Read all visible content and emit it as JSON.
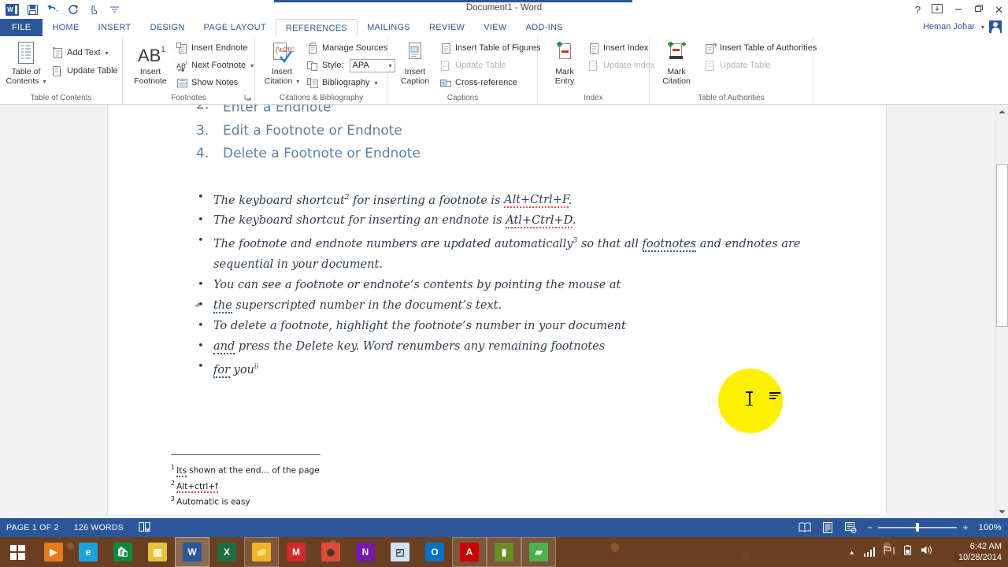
{
  "titlebar": {
    "document_title": "Document1 - Word",
    "quick_access": [
      {
        "name": "word-logo-icon",
        "label": "W"
      },
      {
        "name": "save-icon",
        "label": "💾"
      },
      {
        "name": "undo-icon",
        "label": "↶"
      },
      {
        "name": "redo-icon",
        "label": "↻"
      },
      {
        "name": "touch-mode-icon",
        "label": "☝"
      },
      {
        "name": "customize-qat-icon",
        "label": "≡"
      }
    ],
    "window_controls": [
      {
        "name": "help-button",
        "label": "?"
      },
      {
        "name": "ribbon-display-options-button",
        "label": "⬜"
      },
      {
        "name": "minimize-button",
        "label": "—"
      },
      {
        "name": "restore-button",
        "label": "❐"
      },
      {
        "name": "close-button",
        "label": "✕"
      }
    ]
  },
  "tabs": [
    {
      "label": "FILE",
      "active": false
    },
    {
      "label": "HOME",
      "active": false
    },
    {
      "label": "INSERT",
      "active": false
    },
    {
      "label": "DESIGN",
      "active": false
    },
    {
      "label": "PAGE LAYOUT",
      "active": false
    },
    {
      "label": "REFERENCES",
      "active": true
    },
    {
      "label": "MAILINGS",
      "active": false
    },
    {
      "label": "REVIEW",
      "active": false
    },
    {
      "label": "VIEW",
      "active": false
    },
    {
      "label": "ADD-INS",
      "active": false
    }
  ],
  "account": {
    "name": "Heman Johar",
    "caret": "▾"
  },
  "ribbon": {
    "groups": [
      {
        "name": "table-of-contents",
        "label": "Table of Contents",
        "big_button": {
          "label_line1": "Table of",
          "label_line2": "Contents",
          "caret": "▾"
        },
        "buttons": [
          {
            "label": "Add Text",
            "caret": "▾",
            "disabled": false
          },
          {
            "label": "Update Table",
            "caret": "",
            "disabled": false
          }
        ]
      },
      {
        "name": "footnotes",
        "label": "Footnotes",
        "big_button": {
          "glyph": "AB",
          "sup": "1",
          "label_line1": "Insert",
          "label_line2": "Footnote"
        },
        "buttons": [
          {
            "label": "Insert Endnote",
            "caret": "",
            "disabled": false
          },
          {
            "label": "Next Footnote",
            "caret": "▾",
            "disabled": false
          },
          {
            "label": "Show Notes",
            "caret": "",
            "disabled": false
          }
        ],
        "dialog_launcher": "⤵"
      },
      {
        "name": "citations-bibliography",
        "label": "Citations & Bibliography",
        "big_button": {
          "label_line1": "Insert",
          "label_line2": "Citation",
          "caret": "▾"
        },
        "buttons": [
          {
            "label": "Manage Sources",
            "caret": "",
            "disabled": false
          },
          {
            "label": "Style:",
            "caret": "",
            "disabled": false
          },
          {
            "label": "Bibliography",
            "caret": "▾",
            "disabled": false
          }
        ],
        "style_value": "APA",
        "style_caret": "▾"
      },
      {
        "name": "captions",
        "label": "Captions",
        "big_button": {
          "label_line1": "Insert",
          "label_line2": "Caption"
        },
        "buttons": [
          {
            "label": "Insert Table of Figures",
            "caret": "",
            "disabled": false
          },
          {
            "label": "Update Table",
            "caret": "",
            "disabled": true
          },
          {
            "label": "Cross-reference",
            "caret": "",
            "disabled": false
          }
        ]
      },
      {
        "name": "index",
        "label": "Index",
        "big_button": {
          "label_line1": "Mark",
          "label_line2": "Entry"
        },
        "buttons": [
          {
            "label": "Insert Index",
            "caret": "",
            "disabled": false
          },
          {
            "label": "Update Index",
            "caret": "",
            "disabled": true
          }
        ]
      },
      {
        "name": "table-of-authorities",
        "label": "Table of Authorities",
        "big_button": {
          "label_line1": "Mark",
          "label_line2": "Citation"
        },
        "buttons": [
          {
            "label": "Insert Table of Authorities",
            "caret": "",
            "disabled": false
          },
          {
            "label": "Update Table",
            "caret": "",
            "disabled": true
          }
        ]
      }
    ]
  },
  "document": {
    "numbered_list": [
      {
        "num": "2.",
        "text": "Enter a Endnote",
        "sup": "i"
      },
      {
        "num": "3.",
        "text": "Edit a Footnote or Endnote",
        "sup": ""
      },
      {
        "num": "4.",
        "text": "Delete a Footnote or Endnote",
        "sup": ""
      }
    ],
    "bullets": [
      {
        "parts": [
          {
            "t": "The keyboard shortcut",
            "style": ""
          },
          {
            "t": "2",
            "style": "sup"
          },
          {
            "t": " for inserting a footnote is ",
            "style": ""
          },
          {
            "t": "Alt+Ctrl+F",
            "style": "sp-err"
          },
          {
            "t": ".",
            "style": ""
          }
        ]
      },
      {
        "parts": [
          {
            "t": "The keyboard shortcut for inserting an endnote is ",
            "style": ""
          },
          {
            "t": "Atl+Ctrl+D",
            "style": "sp-err"
          },
          {
            "t": ".",
            "style": ""
          }
        ]
      },
      {
        "parts": [
          {
            "t": "The footnote and endnote numbers are updated automatically",
            "style": ""
          },
          {
            "t": "3",
            "style": "sup"
          },
          {
            "t": " so that all ",
            "style": ""
          },
          {
            "t": "footnotes",
            "style": "gr-err"
          },
          {
            "t": " and endnotes are sequential in your document.",
            "style": ""
          }
        ]
      },
      {
        "parts": [
          {
            "t": "You can see a footnote or endnote’s contents by pointing the mouse at",
            "style": ""
          }
        ]
      },
      {
        "no_bullet": true,
        "parts": [
          {
            "t": "the",
            "style": "gr-err"
          },
          {
            "t": " superscripted number in the document’s text.",
            "style": ""
          }
        ]
      },
      {
        "parts": [
          {
            "t": "To delete a footnote, highlight the footnote’s number in your document",
            "style": ""
          }
        ]
      },
      {
        "no_bullet": true,
        "no_marker": true,
        "parts": [
          {
            "t": "and",
            "style": "gr-err"
          },
          {
            "t": " press the Delete key. Word renumbers any remaining footnotes",
            "style": ""
          }
        ]
      },
      {
        "no_bullet": true,
        "no_marker": true,
        "parts": [
          {
            "t": "for",
            "style": "gr-err"
          },
          {
            "t": " you",
            "style": ""
          },
          {
            "t": "ii",
            "style": "sup"
          }
        ]
      }
    ],
    "footnotes": [
      {
        "num": "1",
        "parts": [
          {
            "t": "Its",
            "style": "gr-err"
          },
          {
            "t": " shown at the end… of the page",
            "style": ""
          }
        ]
      },
      {
        "num": "2",
        "parts": [
          {
            "t": "Alt+ctrl+f",
            "style": "sp-err"
          }
        ]
      },
      {
        "num": "3",
        "parts": [
          {
            "t": "Automatic is easy",
            "style": ""
          }
        ]
      }
    ]
  },
  "statusbar": {
    "page_indicator": "PAGE 1 OF 2",
    "word_count": "126 WORDS",
    "proofing_icon": "proofing-errors-icon",
    "view_buttons": [
      {
        "name": "read-mode-button"
      },
      {
        "name": "print-layout-button"
      },
      {
        "name": "web-layout-button"
      }
    ],
    "zoom_out": "−",
    "zoom_in": "+",
    "zoom_level": "100%"
  },
  "taskbar": {
    "start_label": "Start",
    "items": [
      {
        "name": "taskbar-media-player",
        "glyph": "▶",
        "color": "#e8791a",
        "state": ""
      },
      {
        "name": "taskbar-internet-explorer",
        "glyph": "e",
        "color": "#1ba1e2",
        "state": ""
      },
      {
        "name": "taskbar-store",
        "glyph": "🛍",
        "color": "#0a8a3c",
        "state": ""
      },
      {
        "name": "taskbar-sticky-notes",
        "glyph": "▧",
        "color": "#e8c23a",
        "state": ""
      },
      {
        "name": "taskbar-word",
        "glyph": "W",
        "color": "#2b579a",
        "state": "active"
      },
      {
        "name": "taskbar-excel",
        "glyph": "X",
        "color": "#1d6f42",
        "state": ""
      },
      {
        "name": "taskbar-file-explorer",
        "glyph": "📁",
        "color": "#f0b429",
        "state": "open"
      },
      {
        "name": "taskbar-mendeley",
        "glyph": "M",
        "color": "#cf2a2a",
        "state": ""
      },
      {
        "name": "taskbar-chrome",
        "glyph": "◉",
        "color": "#dd4b39",
        "state": ""
      },
      {
        "name": "taskbar-onenote",
        "glyph": "N",
        "color": "#7719aa",
        "state": ""
      },
      {
        "name": "taskbar-reader",
        "glyph": "◰",
        "color": "#cfe3f5",
        "state": ""
      },
      {
        "name": "taskbar-outlook",
        "glyph": "O",
        "color": "#0072c6",
        "state": ""
      },
      {
        "name": "taskbar-acrobat",
        "glyph": "A",
        "color": "#cc0000",
        "state": "open"
      },
      {
        "name": "taskbar-camtasia",
        "glyph": "▮",
        "color": "#6b8e23",
        "state": "open"
      },
      {
        "name": "taskbar-snagit",
        "glyph": "▰",
        "color": "#4caf50",
        "state": "open"
      }
    ],
    "tray": [
      {
        "name": "show-hidden-icons-icon",
        "glyph": "▲"
      },
      {
        "name": "signal-strength-icon",
        "glyph": ""
      },
      {
        "name": "network-icon",
        "glyph": "⚑"
      },
      {
        "name": "battery-icon",
        "glyph": "▯"
      },
      {
        "name": "volume-icon",
        "glyph": "🔊"
      }
    ],
    "clock": {
      "time": "6:42 AM",
      "date": "10/28/2014"
    }
  }
}
